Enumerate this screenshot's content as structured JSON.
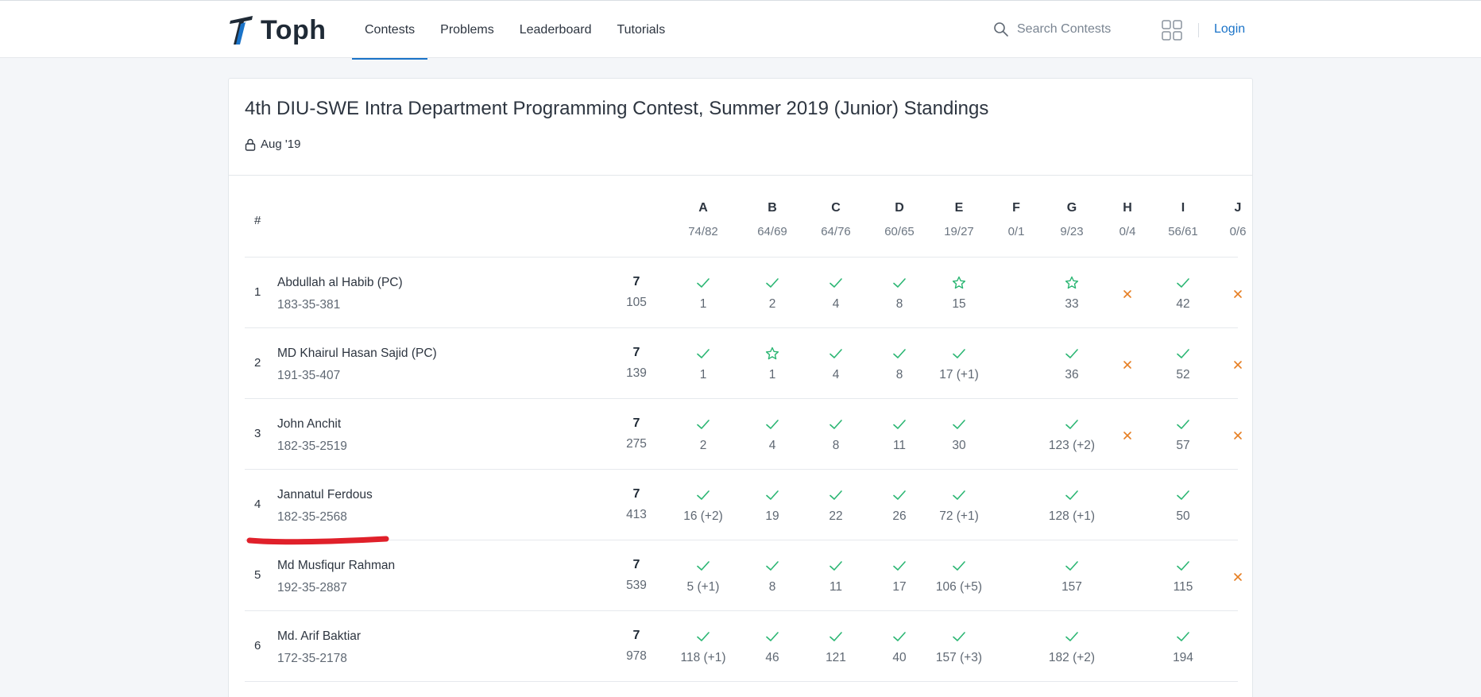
{
  "brand": {
    "name": "Toph"
  },
  "nav": [
    {
      "label": "Contests",
      "active": true
    },
    {
      "label": "Problems",
      "active": false
    },
    {
      "label": "Leaderboard",
      "active": false
    },
    {
      "label": "Tutorials",
      "active": false
    }
  ],
  "search": {
    "placeholder": "Search Contests",
    "value": ""
  },
  "login_label": "Login",
  "contest": {
    "title": "4th DIU-SWE Intra Department Programming Contest, Summer 2019 (Junior) Standings",
    "date": "Aug '19"
  },
  "table": {
    "hash": "#",
    "problems": [
      {
        "letter": "A",
        "ratio": "74/82"
      },
      {
        "letter": "B",
        "ratio": "64/69"
      },
      {
        "letter": "C",
        "ratio": "64/76"
      },
      {
        "letter": "D",
        "ratio": "60/65"
      },
      {
        "letter": "E",
        "ratio": "19/27"
      },
      {
        "letter": "F",
        "ratio": "0/1"
      },
      {
        "letter": "G",
        "ratio": "9/23"
      },
      {
        "letter": "H",
        "ratio": "0/4"
      },
      {
        "letter": "I",
        "ratio": "56/61"
      },
      {
        "letter": "J",
        "ratio": "0/6"
      }
    ],
    "rows": [
      {
        "rank": "1",
        "name": "Abdullah al Habib (PC)",
        "id": "183-35-381",
        "solved": "7",
        "penalty": "105",
        "cells": [
          {
            "status": "ok",
            "time": "1"
          },
          {
            "status": "ok",
            "time": "2"
          },
          {
            "status": "ok",
            "time": "4"
          },
          {
            "status": "ok",
            "time": "8"
          },
          {
            "status": "first",
            "time": "15"
          },
          {
            "status": "none",
            "time": ""
          },
          {
            "status": "first",
            "time": "33"
          },
          {
            "status": "fail",
            "time": ""
          },
          {
            "status": "ok",
            "time": "42"
          },
          {
            "status": "fail",
            "time": ""
          }
        ]
      },
      {
        "rank": "2",
        "name": "MD Khairul Hasan Sajid (PC)",
        "id": "191-35-407",
        "solved": "7",
        "penalty": "139",
        "cells": [
          {
            "status": "ok",
            "time": "1"
          },
          {
            "status": "first",
            "time": "1"
          },
          {
            "status": "ok",
            "time": "4"
          },
          {
            "status": "ok",
            "time": "8"
          },
          {
            "status": "ok",
            "time": "17 (+1)"
          },
          {
            "status": "none",
            "time": ""
          },
          {
            "status": "ok",
            "time": "36"
          },
          {
            "status": "fail",
            "time": ""
          },
          {
            "status": "ok",
            "time": "52"
          },
          {
            "status": "fail",
            "time": ""
          }
        ]
      },
      {
        "rank": "3",
        "name": "John Anchit",
        "id": "182-35-2519",
        "solved": "7",
        "penalty": "275",
        "cells": [
          {
            "status": "ok",
            "time": "2"
          },
          {
            "status": "ok",
            "time": "4"
          },
          {
            "status": "ok",
            "time": "8"
          },
          {
            "status": "ok",
            "time": "11"
          },
          {
            "status": "ok",
            "time": "30"
          },
          {
            "status": "none",
            "time": ""
          },
          {
            "status": "ok",
            "time": "123 (+2)"
          },
          {
            "status": "fail",
            "time": ""
          },
          {
            "status": "ok",
            "time": "57"
          },
          {
            "status": "fail",
            "time": ""
          }
        ]
      },
      {
        "rank": "4",
        "name": "Jannatul Ferdous",
        "id": "182-35-2568",
        "solved": "7",
        "penalty": "413",
        "cells": [
          {
            "status": "ok",
            "time": "16 (+2)"
          },
          {
            "status": "ok",
            "time": "19"
          },
          {
            "status": "ok",
            "time": "22"
          },
          {
            "status": "ok",
            "time": "26"
          },
          {
            "status": "ok",
            "time": "72 (+1)"
          },
          {
            "status": "none",
            "time": ""
          },
          {
            "status": "ok",
            "time": "128 (+1)"
          },
          {
            "status": "none",
            "time": ""
          },
          {
            "status": "ok",
            "time": "50"
          },
          {
            "status": "none",
            "time": ""
          }
        ]
      },
      {
        "rank": "5",
        "name": "Md Musfiqur Rahman",
        "id": "192-35-2887",
        "solved": "7",
        "penalty": "539",
        "cells": [
          {
            "status": "ok",
            "time": "5 (+1)"
          },
          {
            "status": "ok",
            "time": "8"
          },
          {
            "status": "ok",
            "time": "11"
          },
          {
            "status": "ok",
            "time": "17"
          },
          {
            "status": "ok",
            "time": "106 (+5)"
          },
          {
            "status": "none",
            "time": ""
          },
          {
            "status": "ok",
            "time": "157"
          },
          {
            "status": "none",
            "time": ""
          },
          {
            "status": "ok",
            "time": "115"
          },
          {
            "status": "fail",
            "time": ""
          }
        ]
      },
      {
        "rank": "6",
        "name": "Md. Arif Baktiar",
        "id": "172-35-2178",
        "solved": "7",
        "penalty": "978",
        "cells": [
          {
            "status": "ok",
            "time": "118 (+1)"
          },
          {
            "status": "ok",
            "time": "46"
          },
          {
            "status": "ok",
            "time": "121"
          },
          {
            "status": "ok",
            "time": "40"
          },
          {
            "status": "ok",
            "time": "157 (+3)"
          },
          {
            "status": "none",
            "time": ""
          },
          {
            "status": "ok",
            "time": "182 (+2)"
          },
          {
            "status": "none",
            "time": ""
          },
          {
            "status": "ok",
            "time": "194"
          },
          {
            "status": "none",
            "time": ""
          }
        ]
      }
    ]
  },
  "colors": {
    "accent": "#1a73c8",
    "ok": "#2bb673",
    "fail": "#e67e22",
    "annotation": "#e0202a"
  }
}
